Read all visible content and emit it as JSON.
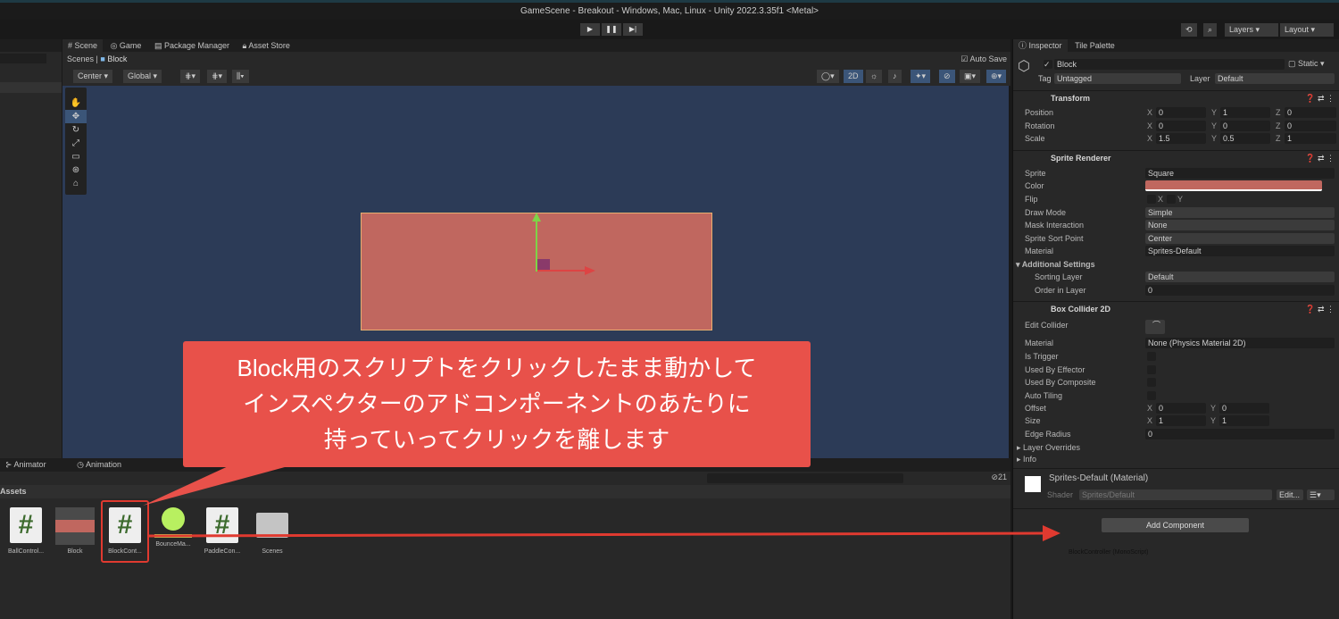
{
  "window": {
    "title": "GameScene - Breakout - Windows, Mac, Linux - Unity 2022.3.35f1 <Metal>"
  },
  "toolbar": {
    "play": "▶",
    "pause": "❚❚",
    "step": "▶|",
    "layers": "Layers",
    "layout": "Layout"
  },
  "scene_tabs": [
    {
      "label": "Scene",
      "icon": "hash-icon"
    },
    {
      "label": "Game",
      "icon": "gamepad-icon"
    },
    {
      "label": "Package Manager",
      "icon": "package-icon"
    },
    {
      "label": "Asset Store",
      "icon": "bag-icon"
    }
  ],
  "breadcrumb": [
    "Scenes",
    "Block"
  ],
  "auto_save": "Auto Save",
  "scene_toolbar": {
    "pivot": "Center",
    "space": "Global",
    "mode_2d": "2D"
  },
  "colors": {
    "block": "#c0675f",
    "callout": "#e8514a",
    "scene_bg": "#2c3b57",
    "accent": "#3b5578"
  },
  "inspector": {
    "tabs": [
      "Inspector",
      "Tile Palette"
    ],
    "object_name": "Block",
    "static_label": "Static",
    "tag_label": "Tag",
    "tag": "Untagged",
    "layer_label": "Layer",
    "layer": "Default",
    "transform": {
      "title": "Transform",
      "position": [
        "0",
        "1",
        "0"
      ],
      "rotation": [
        "0",
        "0",
        "0"
      ],
      "scale": [
        "1.5",
        "0.5",
        "1"
      ],
      "labels": [
        "Position",
        "Rotation",
        "Scale"
      ]
    },
    "sprite_renderer": {
      "title": "Sprite Renderer",
      "sprite_label": "Sprite",
      "sprite": "Square",
      "color_label": "Color",
      "flip_label": "Flip",
      "draw_mode_label": "Draw Mode",
      "draw_mode": "Simple",
      "mask_label": "Mask Interaction",
      "mask": "None",
      "sort_point_label": "Sprite Sort Point",
      "sort_point": "Center",
      "material_label": "Material",
      "material": "Sprites-Default",
      "additional": "Additional Settings",
      "sorting_layer_label": "Sorting Layer",
      "sorting_layer": "Default",
      "order_label": "Order in Layer",
      "order": "0"
    },
    "box_collider": {
      "title": "Box Collider 2D",
      "edit_label": "Edit Collider",
      "material_label": "Material",
      "material": "None (Physics Material 2D)",
      "is_trigger": "Is Trigger",
      "effector": "Used By Effector",
      "composite": "Used By Composite",
      "auto_tiling": "Auto Tiling",
      "offset_label": "Offset",
      "offset": [
        "0",
        "0"
      ],
      "size_label": "Size",
      "size": [
        "1",
        "1"
      ],
      "edge_label": "Edge Radius",
      "edge": "0",
      "layer_overrides": "Layer Overrides",
      "info": "Info"
    },
    "material": {
      "title": "Sprites-Default (Material)",
      "shader_label": "Shader",
      "shader": "Sprites/Default",
      "edit": "Edit..."
    },
    "add_component": "Add Component",
    "drag_label": "BlockController (MonoScript)"
  },
  "bottom": {
    "tabs": [
      "Animator",
      "Animation"
    ],
    "section": "Assets",
    "count": "21",
    "assets": [
      {
        "name": "BallControl...",
        "type": "script"
      },
      {
        "name": "Block",
        "type": "prefab"
      },
      {
        "name": "BlockCont...",
        "type": "script"
      },
      {
        "name": "BounceMa...",
        "type": "physics-material"
      },
      {
        "name": "PaddleCon...",
        "type": "script"
      },
      {
        "name": "Scenes",
        "type": "folder"
      }
    ]
  },
  "callout": {
    "lines": [
      "Block用のスクリプトをクリックしたまま動かして",
      "インスペクターのアドコンポーネントのあたりに",
      "持っていってクリックを離します"
    ]
  }
}
